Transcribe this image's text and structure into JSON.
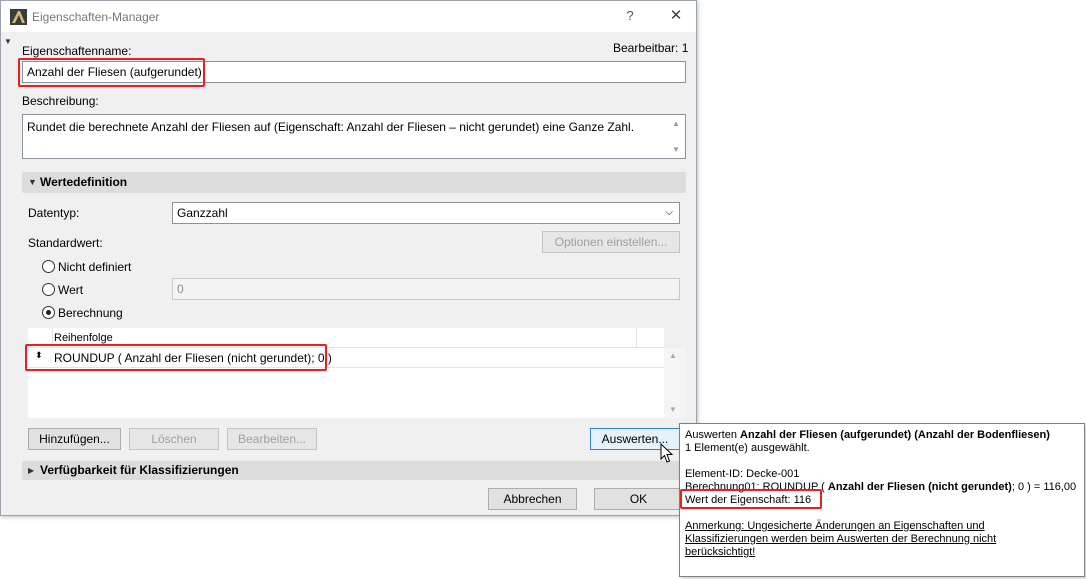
{
  "window": {
    "title": "Eigenschaften-Manager",
    "help": "?",
    "close": "✕"
  },
  "property": {
    "name_label": "Eigenschaftenname:",
    "editable": "Bearbeitbar: 1",
    "name_value": "Anzahl der Fliesen (aufgerundet)",
    "description_label": "Beschreibung:",
    "description_value": "Rundet die berechnete Anzahl der Fliesen auf (Eigenschaft: Anzahl der Fliesen – nicht gerundet) eine  Ganze Zahl."
  },
  "value_definition": {
    "section_title": "Wertedefinition",
    "datatype_label": "Datentyp:",
    "datatype_value": "Ganzzahl",
    "default_label": "Standardwert:",
    "options_button": "Optionen einstellen...",
    "radio_undefined": "Nicht definiert",
    "radio_value": "Wert",
    "value_field": "0",
    "radio_calc": "Berechnung",
    "list_header": "Reihenfolge",
    "formula": "ROUNDUP ( Anzahl der Fliesen (nicht gerundet); 0 )",
    "add_button": "Hinzufügen...",
    "delete_button": "Löschen",
    "edit_button": "Bearbeiten...",
    "evaluate_button": "Auswerten..."
  },
  "classification": {
    "section_title": "Verfügbarkeit für Klassifizierungen"
  },
  "footer": {
    "cancel": "Abbrechen",
    "ok": "OK"
  },
  "popup": {
    "line1_prefix": "Auswerten ",
    "line1_bold": "Anzahl der Fliesen (aufgerundet) (Anzahl der Bodenfliesen)",
    "line2": "1 Element(e) ausgewählt.",
    "element_id": "Element-ID: Decke-001",
    "calc_prefix": "Berechnung01: ROUNDUP ( ",
    "calc_bold": "Anzahl der Fliesen (nicht gerundet)",
    "calc_suffix": "; 0 ) = 116,00",
    "result": "Wert der Eigenschaft: 116",
    "note": "Anmerkung: Ungesicherte Änderungen an Eigenschaften und Klassifizierungen werden beim Auswerten der Berechnung nicht berücksichtigt!"
  },
  "colors": {
    "highlight": "#e8201f",
    "section_bg": "#dcdcdc",
    "dialog_bg": "#f0f0f0"
  }
}
